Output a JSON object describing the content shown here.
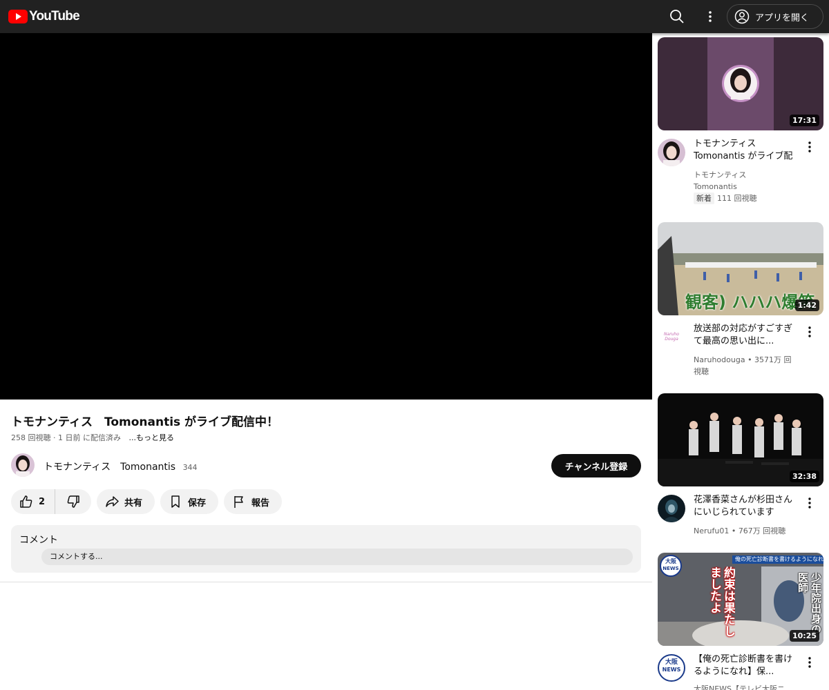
{
  "header": {
    "logo_text": "YouTube",
    "open_app_label": "アプリを開く",
    "brand_color": "#ff0000"
  },
  "video": {
    "title": "トモナンティス　Tomonantis がライブ配信中！",
    "views": "258 回視聴",
    "streamed": "1 日前 に配信済み",
    "more_label": "...もっと見る",
    "channel_name": "トモナンティス　Tomonantis",
    "subscriber_count": "344",
    "subscribe_label": "チャンネル登録",
    "like_count": "2",
    "share_label": "共有",
    "save_label": "保存",
    "report_label": "報告"
  },
  "comments": {
    "title": "コメント",
    "placeholder": "コメントする..."
  },
  "related": [
    {
      "title": "トモナンティス　Tomonantis がライブ配信中！",
      "channel_line1": "トモナンティス",
      "channel_line2": "Tomonantis",
      "badge": "新着",
      "views": "111 回視聴",
      "duration": "17:31",
      "thumb_icon": "woman-portrait-icon"
    },
    {
      "title": "放送部の対応がすごすぎて最高の思い出に...",
      "channel_line1": "Naruhodouga • 3571万 回",
      "channel_line2": "視聴",
      "duration": "1:42",
      "overlay_text": "観客) ハハハ爆笑",
      "avatar_text": "Naruho Douga",
      "thumb_icon": "sports-field-icon"
    },
    {
      "title": "花澤香菜さんが杉田さんにいじられています",
      "channel_line1": "Nerufu01 • 767万 回視聴",
      "duration": "32:38",
      "thumb_icon": "stage-performers-icon"
    },
    {
      "title": "【俺の死亡診断書を書けるようになれ】保...",
      "channel_line1": "大阪NEWS【テレビ大阪ニ",
      "duration": "10:25",
      "thumb_banner": "俺の死亡診断書を書けるようになれ",
      "thumb_caption_a": "約束は果たしましたよ",
      "thumb_caption_b": "少年院出身の医師",
      "logo_text_top": "大阪",
      "logo_text_bottom": "NEWS",
      "thumb_icon": "news-thumbnail-icon"
    }
  ]
}
